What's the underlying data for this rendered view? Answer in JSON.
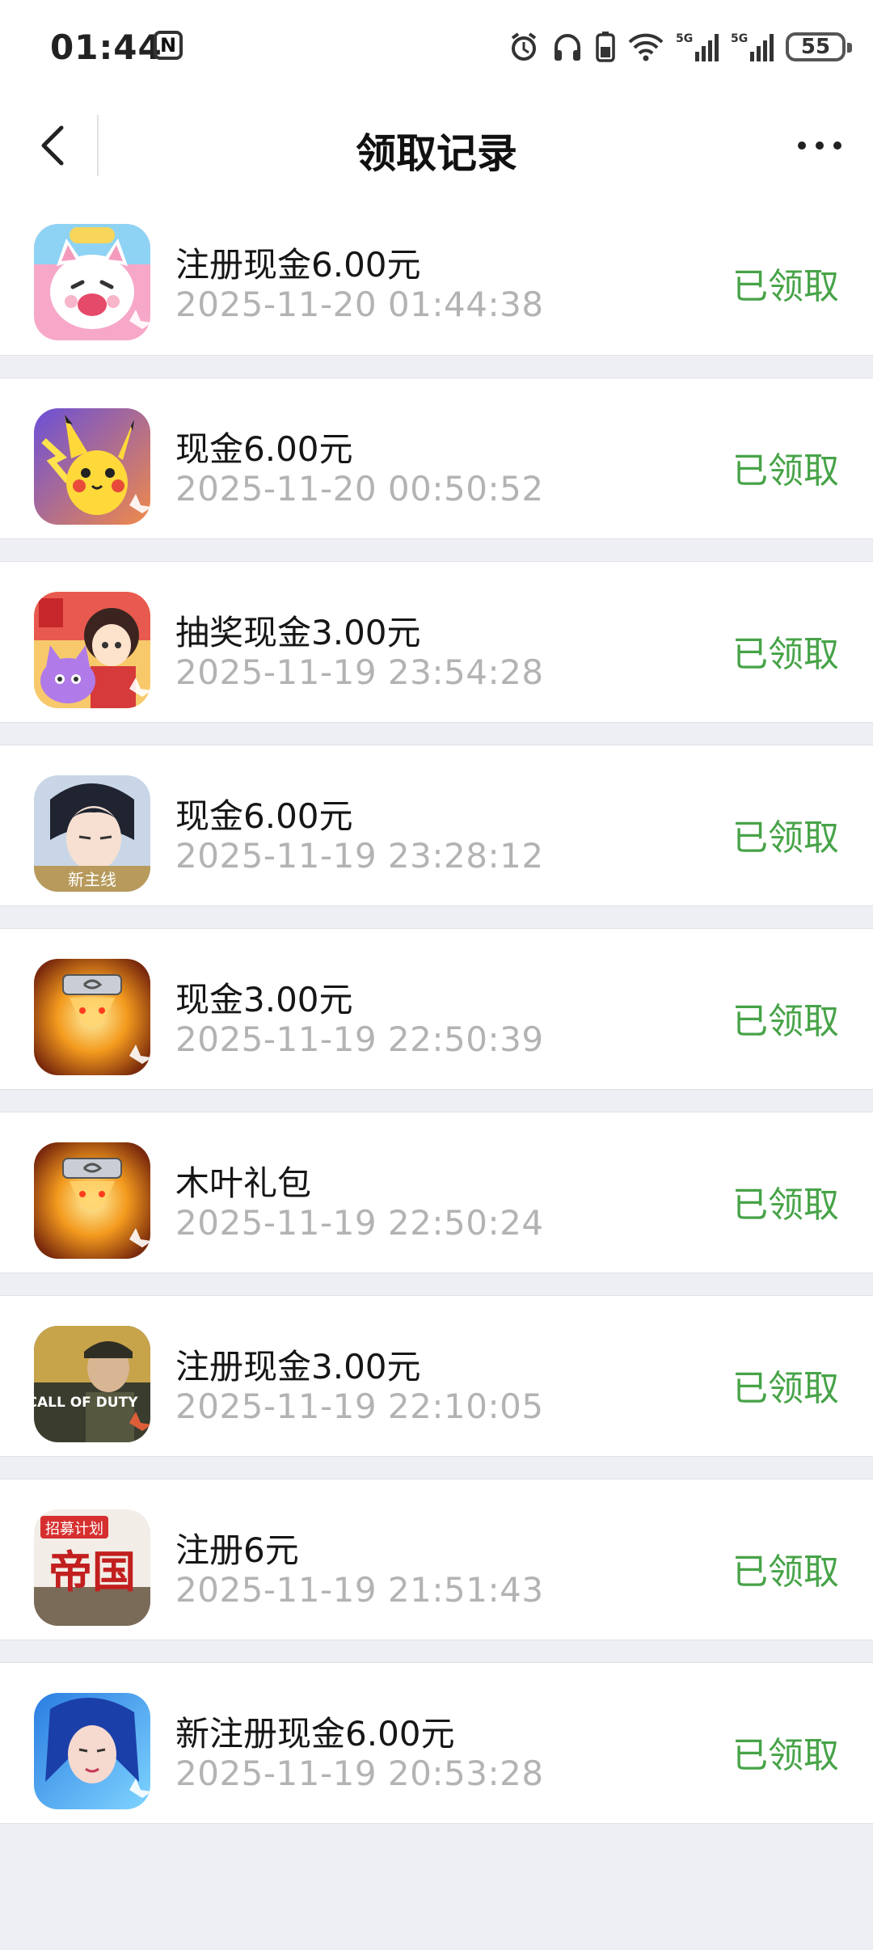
{
  "status_bar": {
    "time": "01:44",
    "nfc": "N",
    "battery": "55"
  },
  "nav": {
    "title": "领取记录"
  },
  "records": [
    {
      "name": "注册现金6.00元",
      "date": "2025-11-20 01:44:38",
      "status": "已领取",
      "icon": "cat-mascot-game-icon"
    },
    {
      "name": "现金6.00元",
      "date": "2025-11-20 00:50:52",
      "status": "已领取",
      "icon": "pikachu-game-icon"
    },
    {
      "name": "抽奖现金3.00元",
      "date": "2025-11-19 23:54:28",
      "status": "已领取",
      "icon": "festival-girl-game-icon"
    },
    {
      "name": "现金6.00元",
      "date": "2025-11-19 23:28:12",
      "status": "已领取",
      "icon": "romance-game-icon",
      "badge": "新主线"
    },
    {
      "name": "现金3.00元",
      "date": "2025-11-19 22:50:39",
      "status": "已领取",
      "icon": "naruto-game-icon"
    },
    {
      "name": "木叶礼包",
      "date": "2025-11-19 22:50:24",
      "status": "已领取",
      "icon": "naruto-game-icon"
    },
    {
      "name": "注册现金3.00元",
      "date": "2025-11-19 22:10:05",
      "status": "已领取",
      "icon": "call-of-duty-game-icon",
      "logo_text": "CALL OF DUTY"
    },
    {
      "name": "注册6元",
      "date": "2025-11-19 21:51:43",
      "status": "已领取",
      "icon": "empire-game-icon",
      "logo_text": "帝国",
      "tag_text": "招募计划"
    },
    {
      "name": "新注册现金6.00元",
      "date": "2025-11-19 20:53:28",
      "status": "已领取",
      "icon": "blue-hair-hero-game-icon"
    }
  ],
  "colors": {
    "accent_green": "#47a348",
    "date_gray": "#b3b3b3",
    "background": "#eeeff4"
  }
}
